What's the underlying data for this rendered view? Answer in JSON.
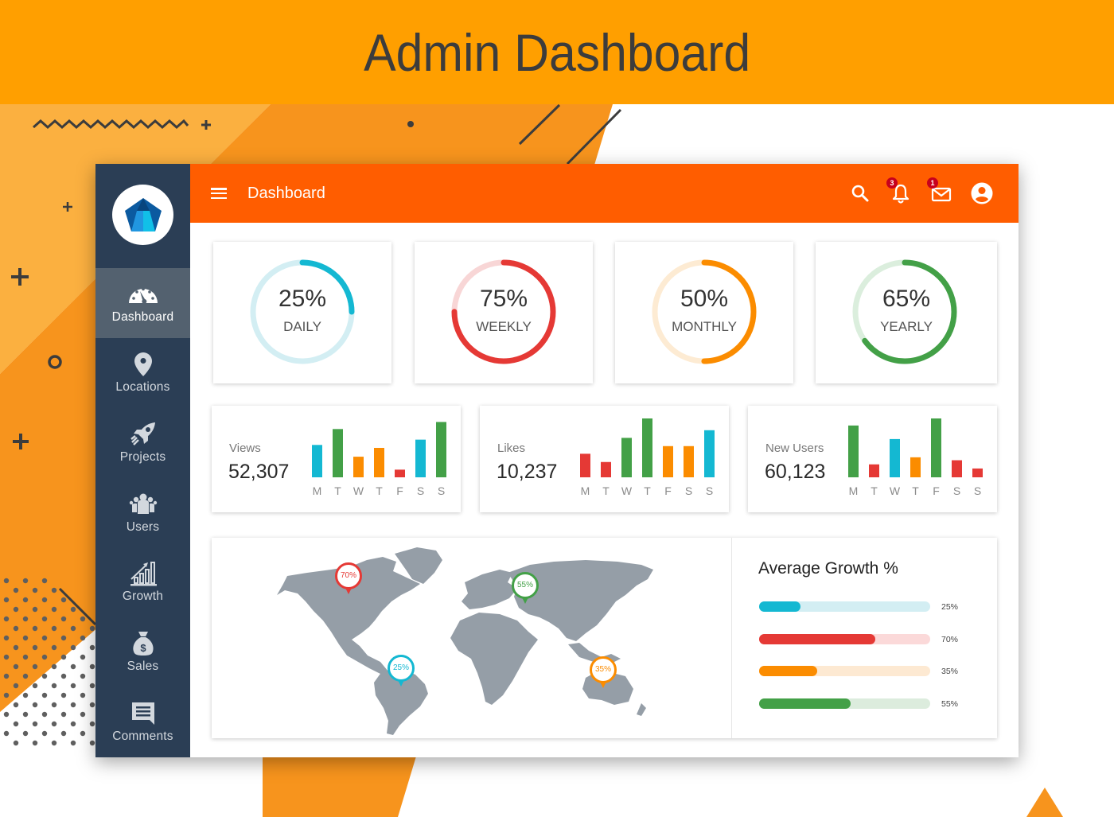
{
  "banner": {
    "title": "Admin Dashboard"
  },
  "colors": {
    "banner": "#ff9f00",
    "topbar": "#ff5d00",
    "sidebar": "#2b3e55",
    "sidebar_active": "#53616f",
    "cyan": "#14b8d2",
    "red": "#e53935",
    "orange": "#fb8c00",
    "green": "#43a047",
    "map_land": "#9aa3ab"
  },
  "topbar": {
    "menu_icon": "hamburger-menu-icon",
    "title": "Dashboard",
    "icons": [
      {
        "name": "search-icon",
        "badge": null
      },
      {
        "name": "bell-icon",
        "badge": "3"
      },
      {
        "name": "mail-icon",
        "badge": "1"
      },
      {
        "name": "account-icon",
        "badge": null
      }
    ]
  },
  "sidebar": {
    "logo": "pentagon-gem-logo",
    "items": [
      {
        "label": "Dashboard",
        "icon": "speedometer-icon",
        "active": true
      },
      {
        "label": "Locations",
        "icon": "map-pin-icon",
        "active": false
      },
      {
        "label": "Projects",
        "icon": "rocket-icon",
        "active": false
      },
      {
        "label": "Users",
        "icon": "users-group-icon",
        "active": false
      },
      {
        "label": "Growth",
        "icon": "growth-chart-icon",
        "active": false
      },
      {
        "label": "Sales",
        "icon": "money-bag-icon",
        "active": false
      },
      {
        "label": "Comments",
        "icon": "comment-icon",
        "active": false
      }
    ]
  },
  "rings": [
    {
      "value": "25%",
      "fraction": 0.25,
      "label": "DAILY",
      "color": "#14b8d2",
      "track": "#d3eef3"
    },
    {
      "value": "75%",
      "fraction": 0.75,
      "label": "WEEKLY",
      "color": "#e53935",
      "track": "#f8d6d6"
    },
    {
      "value": "50%",
      "fraction": 0.5,
      "label": "MONTHLY",
      "color": "#fb8c00",
      "track": "#fdebd3"
    },
    {
      "value": "65%",
      "fraction": 0.65,
      "label": "YEARLY",
      "color": "#43a047",
      "track": "#dbeedd"
    }
  ],
  "chart_data": [
    {
      "type": "bar",
      "title": "Views",
      "total": "52,307",
      "categories": [
        "M",
        "T",
        "W",
        "T",
        "F",
        "S",
        "S"
      ],
      "values": [
        55,
        82,
        35,
        50,
        13,
        64,
        94
      ],
      "bar_colors": [
        "cyan",
        "green",
        "orange",
        "orange",
        "red",
        "cyan",
        "green"
      ],
      "ylim": [
        0,
        100
      ]
    },
    {
      "type": "bar",
      "title": "Likes",
      "total": "10,237",
      "categories": [
        "M",
        "T",
        "W",
        "T",
        "F",
        "S",
        "S"
      ],
      "values": [
        40,
        26,
        67,
        100,
        53,
        53,
        80
      ],
      "bar_colors": [
        "red",
        "red",
        "green",
        "green",
        "orange",
        "orange",
        "cyan"
      ],
      "ylim": [
        0,
        100
      ]
    },
    {
      "type": "bar",
      "title": "New Users",
      "total": "60,123",
      "categories": [
        "M",
        "T",
        "W",
        "T",
        "F",
        "S",
        "S"
      ],
      "values": [
        88,
        22,
        65,
        34,
        100,
        29,
        15
      ],
      "bar_colors": [
        "green",
        "red",
        "cyan",
        "orange",
        "green",
        "red",
        "red"
      ],
      "ylim": [
        0,
        100
      ]
    }
  ],
  "map": {
    "pins": [
      {
        "label": "70%",
        "region": "North America",
        "color": "#e53935"
      },
      {
        "label": "55%",
        "region": "Russia",
        "color": "#43a047"
      },
      {
        "label": "25%",
        "region": "South America",
        "color": "#14b8d2"
      },
      {
        "label": "35%",
        "region": "Australia",
        "color": "#fb8c00"
      }
    ]
  },
  "growth": {
    "title": "Average Growth %",
    "bars": [
      {
        "label": "25%",
        "fraction": 0.25,
        "color": "#14b8d2",
        "track": "#d3eef3"
      },
      {
        "label": "70%",
        "fraction": 0.7,
        "color": "#e53935",
        "track": "#fbd9d9"
      },
      {
        "label": "35%",
        "fraction": 0.35,
        "color": "#fb8c00",
        "track": "#fde9d2"
      },
      {
        "label": "55%",
        "fraction": 0.55,
        "color": "#43a047",
        "track": "#dcecdd"
      }
    ]
  }
}
